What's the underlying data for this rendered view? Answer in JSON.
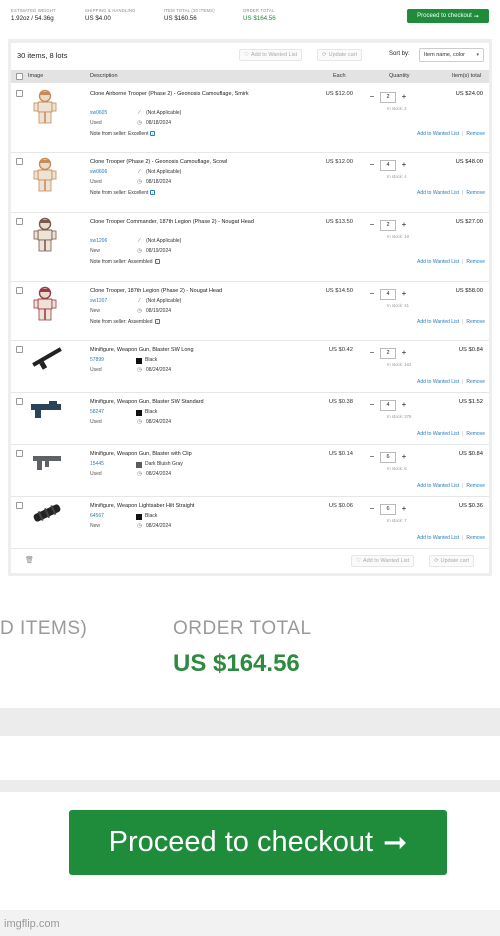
{
  "summary": {
    "weight_label": "ESTIMATED WEIGHT",
    "weight_value": "1.92oz / 54.36g",
    "shipping_label": "SHIPPING & HANDLING",
    "shipping_value": "US $4.00",
    "items_total_label": "ITEM TOTAL (30 ITEMS)",
    "items_total_value": "US $160.56",
    "order_total_label": "ORDER TOTAL",
    "order_total_value": "US $164.56",
    "checkout_label": "Proceed to checkout",
    "checkout_arrow": "➞"
  },
  "toolbar": {
    "items_count": "30 items, 8 lots",
    "add_wanted": "Add to Wanted List",
    "update_cart": "Update cart",
    "sort_by": "Sort by:",
    "sort_value": "Item name, color"
  },
  "columns": {
    "image": "Image",
    "description": "Description",
    "each": "Each",
    "quantity": "Quantity",
    "total": "Item(s) total"
  },
  "items": [
    {
      "name": "Clone Airborne Trooper (Phase 2) - Geonosis Camouflage, Smirk",
      "part": "sw0605",
      "condition": "Used",
      "color": "(Not Applicable)",
      "date": "08/18/2024",
      "note": "Note from seller:",
      "note_value": "Excellent",
      "each": "US $12.00",
      "qty": "2",
      "stock": "In stock: 2",
      "total": "US $24.00"
    },
    {
      "name": "Clone Trooper (Phase 2) - Geonosis Camouflage, Scowl",
      "part": "sw0606",
      "condition": "Used",
      "color": "(Not Applicable)",
      "date": "08/18/2024",
      "note": "Note from seller:",
      "note_value": "Excellent",
      "each": "US $12.00",
      "qty": "4",
      "stock": "In stock: 4",
      "total": "US $48.00"
    },
    {
      "name": "Clone Trooper Commander, 187th Legion (Phase 2) - Nougat Head",
      "part": "sw1206",
      "condition": "New",
      "color": "(Not Applicable)",
      "date": "08/19/2024",
      "note": "Note from seller:",
      "note_value": "Assembled",
      "each": "US $13.50",
      "qty": "2",
      "stock": "In stock: 19",
      "total": "US $27.00"
    },
    {
      "name": "Clone Trooper, 187th Legion (Phase 2) - Nougat Head",
      "part": "sw1207",
      "condition": "New",
      "color": "(Not Applicable)",
      "date": "08/19/2024",
      "note": "Note from seller:",
      "note_value": "Assembled",
      "each": "US $14.50",
      "qty": "4",
      "stock": "In stock: 41",
      "total": "US $58.00"
    },
    {
      "name": "Minifigure, Weapon Gun, Blaster SW Long",
      "part": "57899",
      "condition": "Used",
      "color": "Black",
      "date": "08/24/2024",
      "each": "US $0.42",
      "qty": "2",
      "stock": "In stock: 162",
      "total": "US $0.84"
    },
    {
      "name": "Minifigure, Weapon Gun, Blaster SW Standard",
      "part": "58247",
      "condition": "Used",
      "color": "Black",
      "date": "08/24/2024",
      "each": "US $0.38",
      "qty": "4",
      "stock": "In stock: 378",
      "total": "US $1.52"
    },
    {
      "name": "Minifigure, Weapon Gun, Blaster with Clip",
      "part": "15445",
      "condition": "Used",
      "color": "Dark Bluish Gray",
      "date": "08/24/2024",
      "each": "US $0.14",
      "qty": "6",
      "stock": "In stock: 6",
      "total": "US $0.84"
    },
    {
      "name": "Minifigure, Weapon Lightsaber Hilt Straight",
      "part": "64567",
      "condition": "New",
      "color": "Black",
      "date": "08/24/2024",
      "each": "US $0.06",
      "qty": "6",
      "stock": "In stock: 7",
      "total": "US $0.36"
    }
  ],
  "row_actions": {
    "wanted": "Add to Wanted List",
    "remove": "Remove"
  },
  "zoom": {
    "items_label": "D ITEMS)",
    "order_total_label": "ORDER TOTAL",
    "order_total_value": "US $164.56",
    "checkout_label": "Proceed to checkout",
    "checkout_arrow": "➞"
  },
  "watermark": "imgflip.com",
  "colors": {
    "accent_green": "#1e8c3a",
    "link_blue": "#2a7bc0",
    "swatch_black": "#111111",
    "swatch_dark_bluish_gray": "#595d60"
  }
}
